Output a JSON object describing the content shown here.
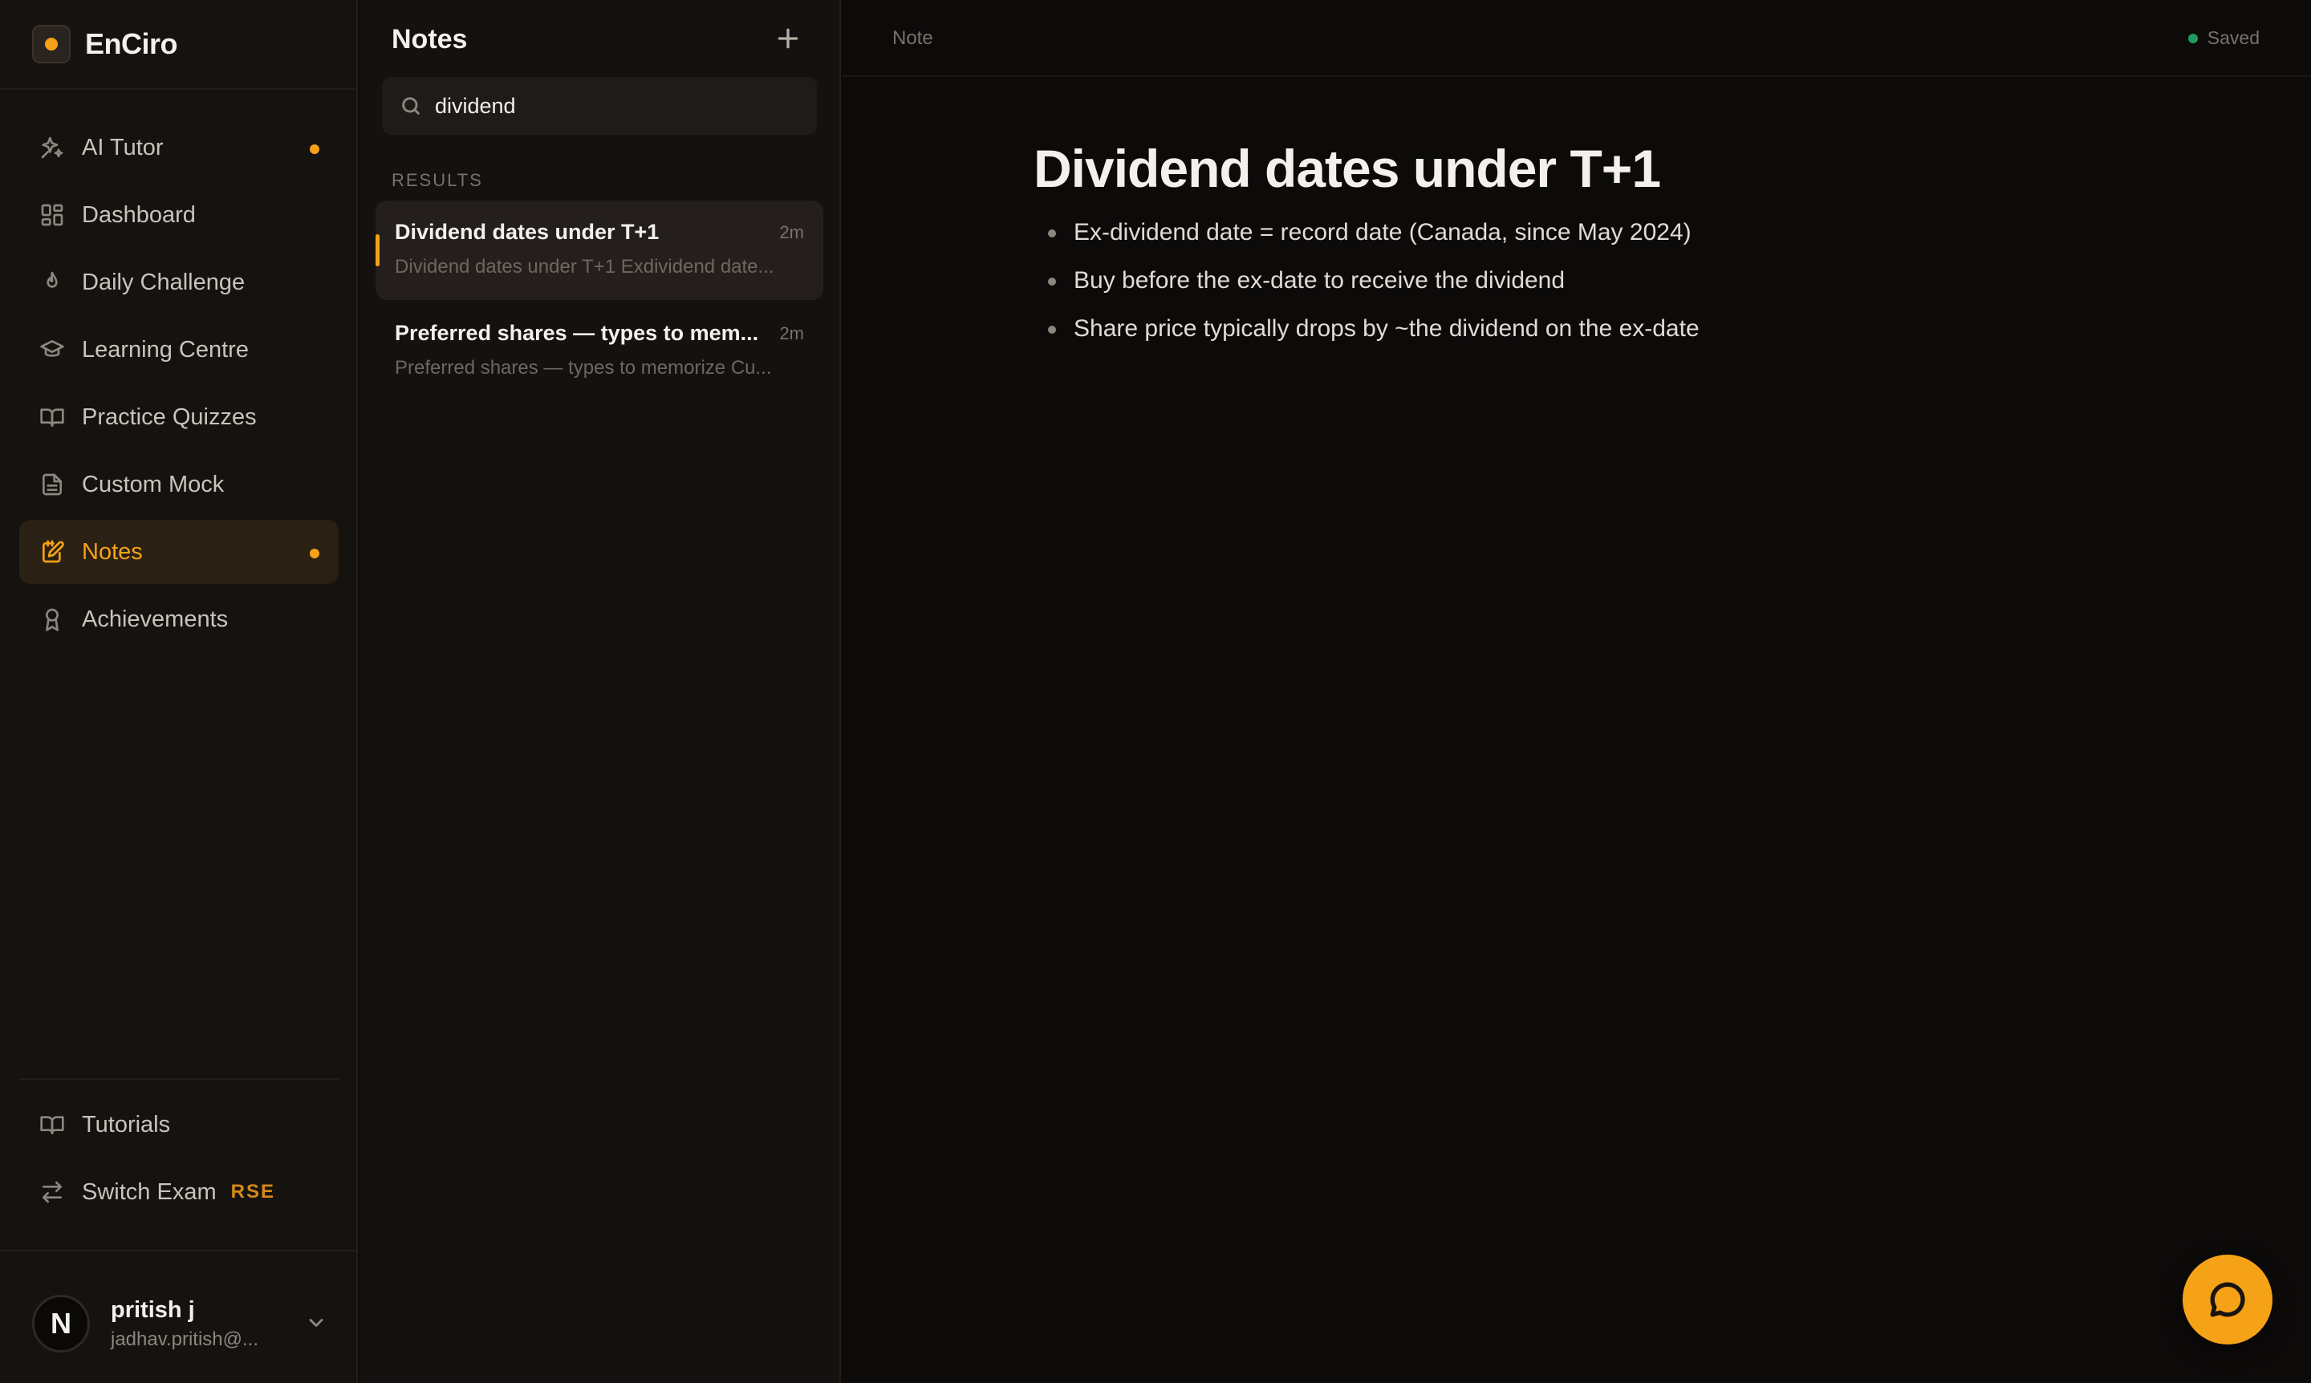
{
  "brand": {
    "name": "EnCiro"
  },
  "sidebar": {
    "items": [
      {
        "label": "AI Tutor",
        "icon": "sparkles-icon",
        "dot": true
      },
      {
        "label": "Dashboard",
        "icon": "grid-icon"
      },
      {
        "label": "Daily Challenge",
        "icon": "flame-icon"
      },
      {
        "label": "Learning Centre",
        "icon": "graduation-cap-icon"
      },
      {
        "label": "Practice Quizzes",
        "icon": "book-open-icon"
      },
      {
        "label": "Custom Mock",
        "icon": "document-icon"
      },
      {
        "label": "Notes",
        "icon": "notepad-pen-icon",
        "dot": true,
        "active": true
      },
      {
        "label": "Achievements",
        "icon": "award-icon"
      }
    ],
    "bottom": {
      "tutorials": "Tutorials",
      "switch_exam": "Switch Exam",
      "exam_code": "RSE"
    }
  },
  "user": {
    "initial": "N",
    "name": "pritish j",
    "email": "jadhav.pritish@..."
  },
  "notes_panel": {
    "title": "Notes",
    "search_value": "dividend",
    "results_label": "RESULTS",
    "results": [
      {
        "title": "Dividend dates under T+1",
        "time": "2m",
        "preview": "Dividend dates under T+1 Exdividend date..."
      },
      {
        "title": "Preferred shares — types to mem...",
        "time": "2m",
        "preview": "Preferred shares — types to memorize Cu..."
      }
    ]
  },
  "editor": {
    "breadcrumb": "Note",
    "status": "Saved",
    "title": "Dividend dates under T+1",
    "bullets": [
      "Ex-dividend date = record date (Canada, since May 2024)",
      "Buy before the ex-date to receive the dividend",
      "Share price typically drops by ~the dividend on the ex-date"
    ]
  },
  "colors": {
    "accent": "#f5a217",
    "saved_dot": "#1f9a5f"
  }
}
